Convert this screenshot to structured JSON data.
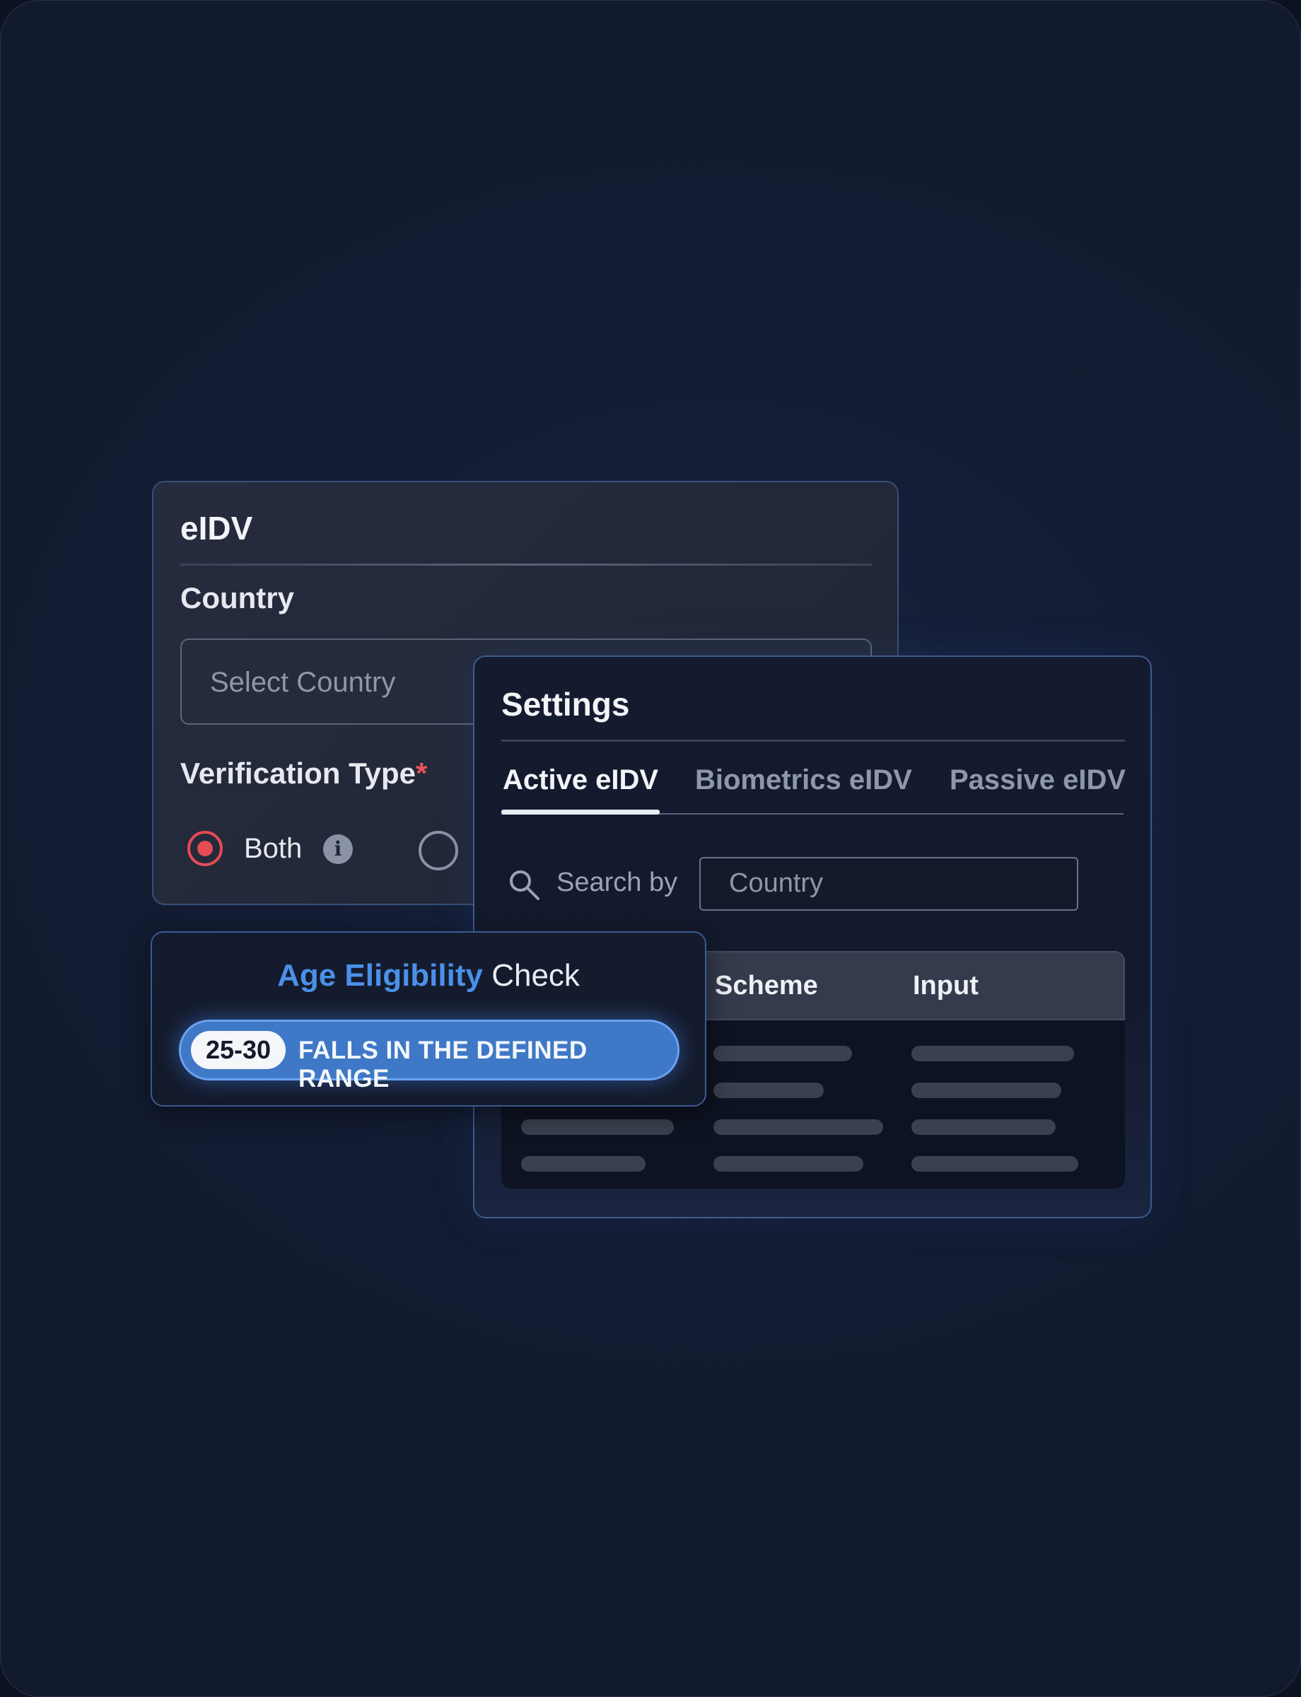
{
  "eidv_card": {
    "title": "eIDV",
    "country_label": "Country",
    "country_placeholder": "Select Country",
    "verification_type_label": "Verification Type",
    "required_marker": "*",
    "options": [
      {
        "label": "Both",
        "selected": true
      }
    ],
    "info_icon_glyph": "i"
  },
  "settings_card": {
    "title": "Settings",
    "tabs": [
      {
        "label": "Active eIDV",
        "active": true
      },
      {
        "label": "Biometrics eIDV",
        "active": false
      },
      {
        "label": "Passive eIDV",
        "active": false
      }
    ],
    "search_label": "Search by",
    "search_placeholder": "Country",
    "table": {
      "columns": [
        "Scheme",
        "Input"
      ]
    }
  },
  "age_card": {
    "title_accent": "Age Eligibility",
    "title_rest": "Check",
    "range": "25-30",
    "status": "FALLS IN THE DEFINED RANGE"
  },
  "colors": {
    "background": "#121a2f",
    "accent_blue": "#4a90e8",
    "radio_selected": "#e64a55",
    "pill_blue": "#3f78c6"
  }
}
